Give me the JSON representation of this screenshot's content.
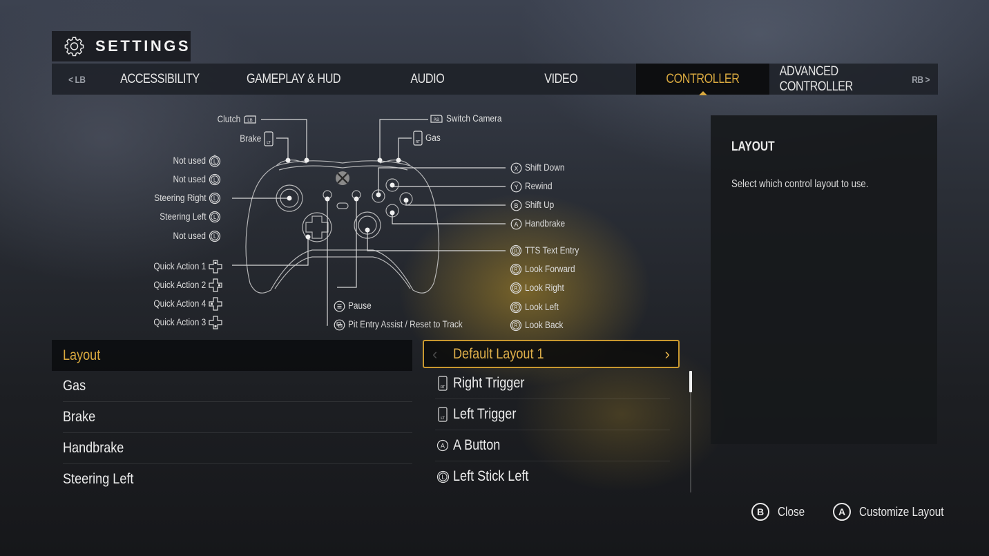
{
  "header": {
    "title": "SETTINGS",
    "icon": "gear-icon"
  },
  "tabs": {
    "left_bumper": "< LB",
    "right_bumper": "RB >",
    "items": [
      {
        "label": "ACCESSIBILITY",
        "active": false
      },
      {
        "label": "GAMEPLAY & HUD",
        "active": false
      },
      {
        "label": "AUDIO",
        "active": false
      },
      {
        "label": "VIDEO",
        "active": false
      },
      {
        "label": "CONTROLLER",
        "active": true
      },
      {
        "label": "ADVANCED CONTROLLER",
        "active": false
      }
    ]
  },
  "diagram": {
    "left_labels": [
      {
        "label": "Clutch",
        "button": "LB"
      },
      {
        "label": "Brake",
        "button": "LT"
      },
      {
        "label": "Not used",
        "button": "L-stick-up"
      },
      {
        "label": "Not used",
        "button": "L-stick-down"
      },
      {
        "label": "Steering Right",
        "button": "L-stick-right"
      },
      {
        "label": "Steering Left",
        "button": "L-stick-left"
      },
      {
        "label": "Not used",
        "button": "L-stick-click"
      },
      {
        "label": "Quick Action 1",
        "button": "dpad-up"
      },
      {
        "label": "Quick Action 2",
        "button": "dpad-right"
      },
      {
        "label": "Quick Action 4",
        "button": "dpad-left"
      },
      {
        "label": "Quick Action 3",
        "button": "dpad-down"
      }
    ],
    "right_labels": [
      {
        "label": "Switch Camera",
        "button": "RB"
      },
      {
        "label": "Gas",
        "button": "RT"
      },
      {
        "label": "Shift Down",
        "button": "X"
      },
      {
        "label": "Rewind",
        "button": "Y"
      },
      {
        "label": "Shift Up",
        "button": "B"
      },
      {
        "label": "Handbrake",
        "button": "A"
      },
      {
        "label": "TTS Text Entry",
        "button": "R-stick-click"
      },
      {
        "label": "Look Forward",
        "button": "R-stick-up"
      },
      {
        "label": "Look Right",
        "button": "R-stick-right"
      },
      {
        "label": "Look Left",
        "button": "R-stick-left"
      },
      {
        "label": "Look Back",
        "button": "R-stick-down"
      }
    ],
    "bottom_labels": [
      {
        "label": "Pause",
        "button": "menu"
      },
      {
        "label": "Pit Entry Assist / Reset to Track",
        "button": "view"
      }
    ]
  },
  "bindings": {
    "selected_index": 0,
    "rows": [
      {
        "action": "Layout",
        "value": "Default Layout 1",
        "icon": ""
      },
      {
        "action": "Gas",
        "value": "Right Trigger",
        "icon": "RT"
      },
      {
        "action": "Brake",
        "value": "Left Trigger",
        "icon": "LT"
      },
      {
        "action": "Handbrake",
        "value": "A Button",
        "icon": "A"
      },
      {
        "action": "Steering Left",
        "value": "Left Stick Left",
        "icon": "L"
      }
    ],
    "scroll_fraction_visible": 0.18
  },
  "info_panel": {
    "title": "LAYOUT",
    "description": "Select which control layout to use."
  },
  "footer": {
    "buttons": [
      {
        "glyph": "B",
        "label": "Close"
      },
      {
        "glyph": "A",
        "label": "Customize Layout"
      }
    ]
  },
  "colors": {
    "accent": "#d9a93f",
    "text": "#e6e6e6",
    "panel": "#16181b"
  }
}
